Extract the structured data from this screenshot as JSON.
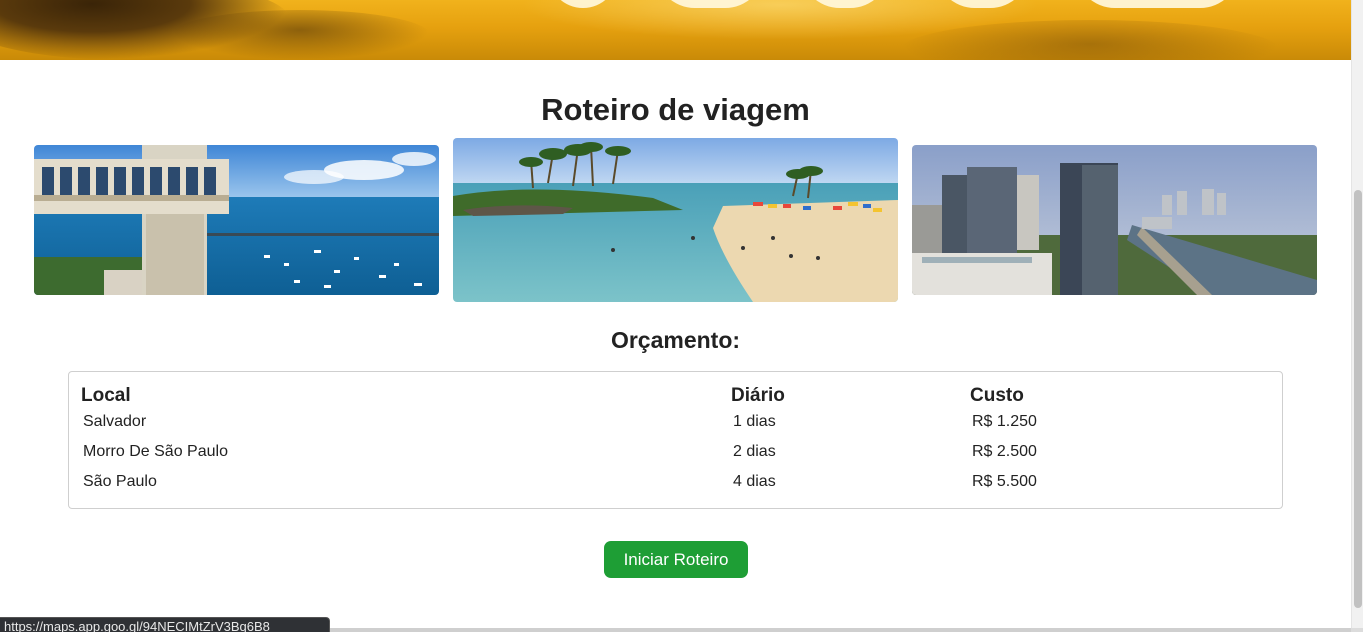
{
  "page": {
    "title": "Roteiro de viagem",
    "budget_title": "Orçamento:"
  },
  "images": [
    {
      "name": "salvador-elevador-lacerda",
      "alt": "Salvador"
    },
    {
      "name": "morro-de-sao-paulo-beach",
      "alt": "Morro De São Paulo"
    },
    {
      "name": "sao-paulo-skyline",
      "alt": "São Paulo"
    }
  ],
  "table": {
    "headers": [
      "Local",
      "Diário",
      "Custo"
    ],
    "rows": [
      {
        "local": "Salvador",
        "diario": "1 dias",
        "custo": "R$ 1.250"
      },
      {
        "local": "Morro De São Paulo",
        "diario": "2 dias",
        "custo": "R$ 2.500"
      },
      {
        "local": "São Paulo",
        "diario": "4 dias",
        "custo": "R$ 5.500"
      }
    ]
  },
  "actions": {
    "start_label": "Iniciar Roteiro"
  },
  "status_bar": {
    "url": "https://maps.app.goo.gl/94NECIMtZrV3Bq6B8"
  },
  "colors": {
    "button_green": "#1e9e35",
    "banner_gold": "#e6a10f"
  }
}
